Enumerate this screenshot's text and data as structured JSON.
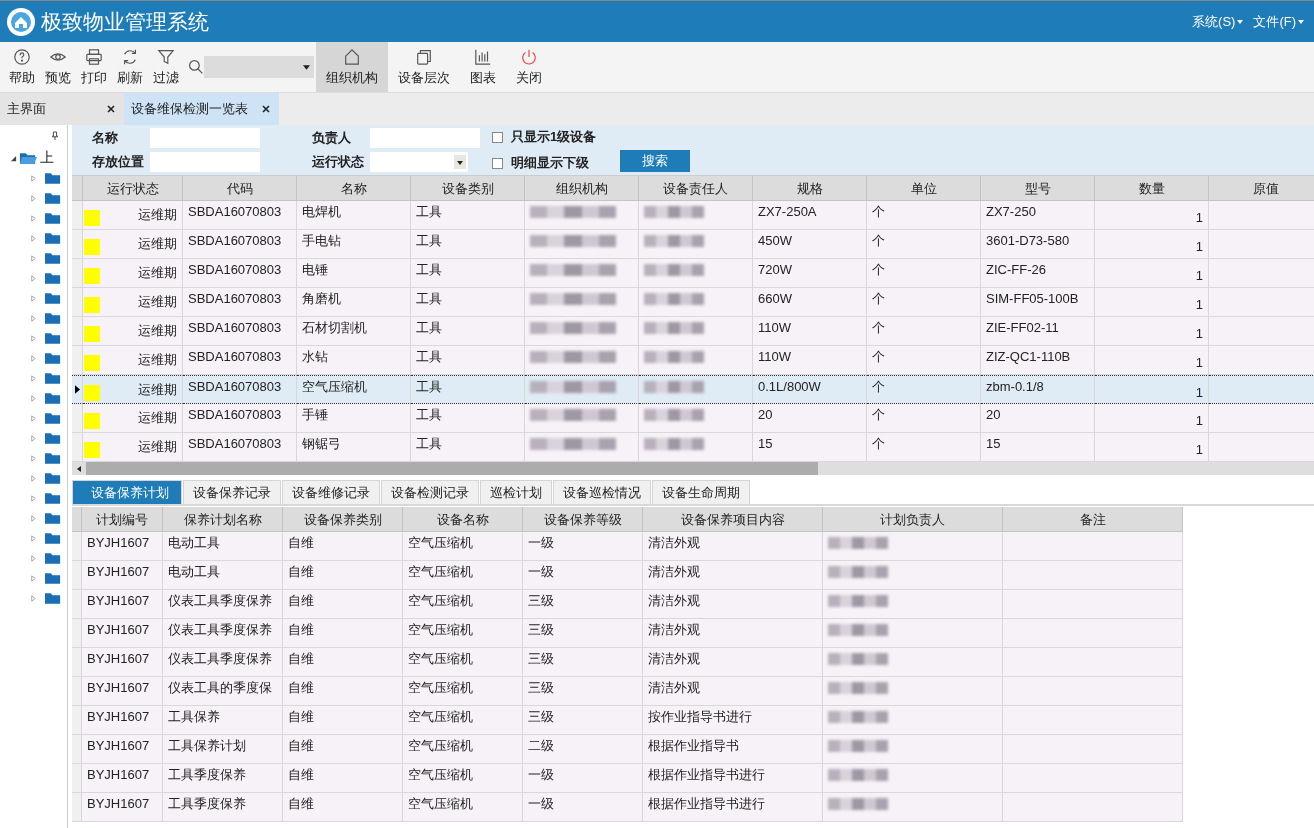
{
  "app": {
    "title": "极致物业管理系统",
    "menus": [
      {
        "label": "系统(S)"
      },
      {
        "label": "文件(F)"
      }
    ]
  },
  "toolbar": {
    "buttons": [
      {
        "label": "帮助",
        "selected": false
      },
      {
        "label": "预览",
        "selected": false
      },
      {
        "label": "打印",
        "selected": false
      },
      {
        "label": "刷新",
        "selected": false
      },
      {
        "label": "过滤",
        "selected": false
      }
    ],
    "views": [
      {
        "label": "组织机构",
        "selected": true
      },
      {
        "label": "设备层次",
        "selected": false
      },
      {
        "label": "图表",
        "selected": false
      },
      {
        "label": "关闭",
        "selected": false
      }
    ]
  },
  "doc_tabs": [
    {
      "label": "主界面",
      "selected": false
    },
    {
      "label": "设备维保检测一览表",
      "selected": true
    }
  ],
  "tree": {
    "label": "上",
    "expanded": true,
    "children": [
      {
        "expanded": false
      },
      {
        "expanded": false
      },
      {
        "expanded": false
      },
      {
        "expanded": false
      },
      {
        "expanded": false
      },
      {
        "expanded": false
      },
      {
        "expanded": false
      },
      {
        "expanded": false
      },
      {
        "expanded": false
      },
      {
        "expanded": false
      },
      {
        "expanded": false
      },
      {
        "expanded": false
      },
      {
        "expanded": false
      },
      {
        "expanded": false
      },
      {
        "expanded": false
      },
      {
        "expanded": false
      },
      {
        "expanded": false
      },
      {
        "expanded": false
      },
      {
        "expanded": false
      },
      {
        "expanded": false
      },
      {
        "expanded": false
      },
      {
        "expanded": false
      }
    ]
  },
  "filter": {
    "fields": [
      {
        "label": "名称",
        "kind": "text"
      },
      {
        "label": "负责人",
        "kind": "text"
      },
      {
        "label": "存放位置",
        "kind": "text"
      },
      {
        "label": "运行状态",
        "kind": "select"
      }
    ],
    "checks": [
      {
        "label": "只显示1级设备",
        "checked": false
      },
      {
        "label": "明细显示下级",
        "checked": false
      }
    ],
    "search_button": "搜索"
  },
  "equipment": {
    "columns": [
      "运行状态",
      "代码",
      "名称",
      "设备类别",
      "组织机构",
      "设备责任人",
      "规格",
      "单位",
      "型号",
      "数量",
      "原值"
    ],
    "rows": [
      {
        "color": "#ffff00",
        "status": "运维期",
        "code": "SBDA16070803",
        "name": "电焊机",
        "category": "工具",
        "spec": "ZX7-250A",
        "unit": "个",
        "model": "ZX7-250",
        "qty": "1",
        "selected": false
      },
      {
        "color": "#ffff00",
        "status": "运维期",
        "code": "SBDA16070803",
        "name": "手电钻",
        "category": "工具",
        "spec": "450W",
        "unit": "个",
        "model": "3601-D73-580",
        "qty": "1",
        "selected": false
      },
      {
        "color": "#ffff00",
        "status": "运维期",
        "code": "SBDA16070803",
        "name": "电锤",
        "category": "工具",
        "spec": "720W",
        "unit": "个",
        "model": "ZIC-FF-26",
        "qty": "1",
        "selected": false
      },
      {
        "color": "#ffff00",
        "status": "运维期",
        "code": "SBDA16070803",
        "name": "角磨机",
        "category": "工具",
        "spec": "660W",
        "unit": "个",
        "model": "SIM-FF05-100B",
        "qty": "1",
        "selected": false
      },
      {
        "color": "#ffff00",
        "status": "运维期",
        "code": "SBDA16070803",
        "name": "石材切割机",
        "category": "工具",
        "spec": "110W",
        "unit": "个",
        "model": "ZIE-FF02-11",
        "qty": "1",
        "selected": false
      },
      {
        "color": "#ffff00",
        "status": "运维期",
        "code": "SBDA16070803",
        "name": "水钻",
        "category": "工具",
        "spec": "110W",
        "unit": "个",
        "model": "ZIZ-QC1-110B",
        "qty": "1",
        "selected": false
      },
      {
        "color": "#ffff00",
        "status": "运维期",
        "code": "SBDA16070803",
        "name": "空气压缩机",
        "category": "工具",
        "spec": "0.1L/800W",
        "unit": "个",
        "model": "zbm-0.1/8",
        "qty": "1",
        "selected": true
      },
      {
        "color": "#ffff00",
        "status": "运维期",
        "code": "SBDA16070803",
        "name": "手锤",
        "category": "工具",
        "spec": "20",
        "unit": "个",
        "model": "20",
        "qty": "1",
        "selected": false
      },
      {
        "color": "#ffff00",
        "status": "运维期",
        "code": "SBDA16070803",
        "name": "钢锯弓",
        "category": "工具",
        "spec": "15",
        "unit": "个",
        "model": "15",
        "qty": "1",
        "selected": false
      }
    ]
  },
  "detail_tabs": [
    {
      "label": "设备保养计划",
      "selected": true
    },
    {
      "label": "设备保养记录",
      "selected": false
    },
    {
      "label": "设备维修记录",
      "selected": false
    },
    {
      "label": "设备检测记录",
      "selected": false
    },
    {
      "label": "巡检计划",
      "selected": false
    },
    {
      "label": "设备巡检情况",
      "selected": false
    },
    {
      "label": "设备生命周期",
      "selected": false
    }
  ],
  "plans": {
    "columns": [
      "计划编号",
      "保养计划名称",
      "设备保养类别",
      "设备名称",
      "设备保养等级",
      "设备保养项目内容",
      "计划负责人",
      "备注"
    ],
    "rows": [
      {
        "no": "BYJH1607",
        "name": "电动工具",
        "type": "自维",
        "device": "空气压缩机",
        "level_text": "一级",
        "content": "清洁外观"
      },
      {
        "no": "BYJH1607",
        "name": "电动工具",
        "type": "自维",
        "device": "空气压缩机",
        "level_text": "一级",
        "content": "清洁外观"
      },
      {
        "no": "BYJH1607",
        "name": "仪表工具季度保养",
        "type": "自维",
        "device": "空气压缩机",
        "level_text": "三级",
        "content": "清洁外观"
      },
      {
        "no": "BYJH1607",
        "name": "仪表工具季度保养",
        "type": "自维",
        "device": "空气压缩机",
        "level_text": "三级",
        "content": "清洁外观"
      },
      {
        "no": "BYJH1607",
        "name": "仪表工具季度保养",
        "type": "自维",
        "device": "空气压缩机",
        "level_text": "三级",
        "content": "清洁外观"
      },
      {
        "no": "BYJH1607",
        "name": "仪表工具的季度保",
        "type": "自维",
        "device": "空气压缩机",
        "level_text": "三级",
        "content": "清洁外观"
      },
      {
        "no": "BYJH1607",
        "name": "工具保养",
        "type": "自维",
        "device": "空气压缩机",
        "level_text": "三级",
        "content": "按作业指导书进行"
      },
      {
        "no": "BYJH1607",
        "name": "工具保养计划",
        "type": "自维",
        "device": "空气压缩机",
        "level_text": "二级",
        "content": "根据作业指导书"
      },
      {
        "no": "BYJH1607",
        "name": "工具季度保养",
        "type": "自维",
        "device": "空气压缩机",
        "level_text": "一级",
        "content": "根据作业指导书进行"
      },
      {
        "no": "BYJH1607",
        "name": "工具季度保养",
        "type": "自维",
        "device": "空气压缩机",
        "level_text": "一级",
        "content": "根据作业指导书进行"
      }
    ]
  }
}
